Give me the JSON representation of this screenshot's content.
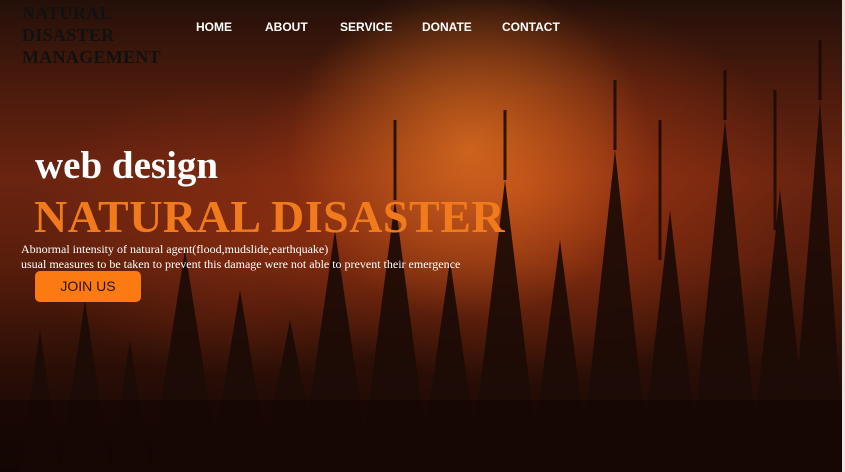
{
  "logo": {
    "line1": "NATURAL",
    "line2": "DISASTER",
    "line3": "MANAGEMENT"
  },
  "nav": {
    "items": [
      {
        "label": "HOME"
      },
      {
        "label": "ABOUT"
      },
      {
        "label": "SERVICE"
      },
      {
        "label": "DONATE"
      },
      {
        "label": "CONTACT"
      }
    ]
  },
  "hero": {
    "subtitle": "web design",
    "title": "NATURAL DISASTER",
    "description_line1": "Abnormal intensity of natural agent(flood,mudslide,earthquake)",
    "description_line2": "usual measures to be taken to prevent this damage were not able to prevent their emergence",
    "cta_label": "JOIN US"
  },
  "colors": {
    "accent": "#f07a1c",
    "button": "#fb7a12",
    "nav_text": "#ffffff",
    "logo_text": "#111111"
  }
}
